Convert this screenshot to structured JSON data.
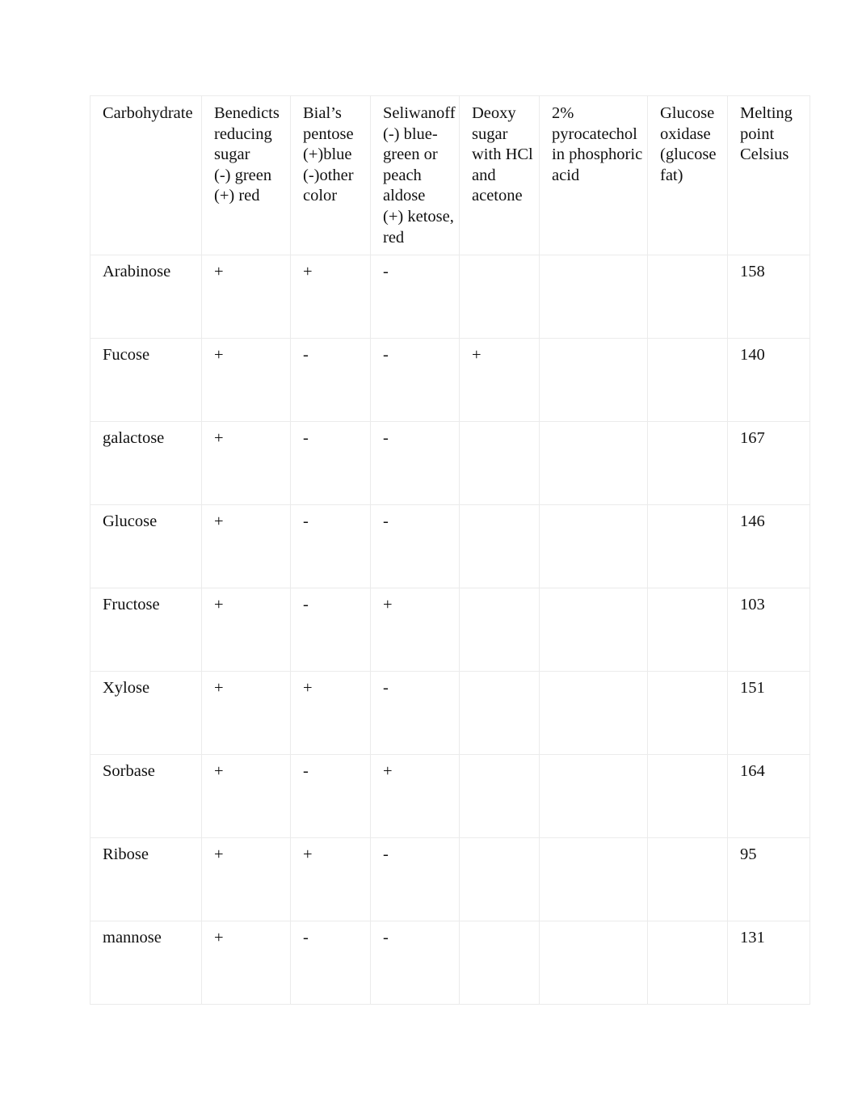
{
  "document": {
    "page_background": "#ffffff",
    "table_border_color": "#ebebeb",
    "text_color": "#111111"
  },
  "table": {
    "headers": [
      "Carbohydrate",
      "Benedicts reducing sugar\n(-) green\n(+) red",
      "Bial’s pentose\n(+)blue\n(-)other color",
      "Seliwanoff\n(-) blue-green or peach aldose\n(+) ketose, red",
      "Deoxy sugar with HCl and acetone",
      "2% pyrocatechol in phosphoric acid",
      "Glucose oxidase (glucose fat)",
      "Melting point Celsius"
    ],
    "rows": [
      {
        "carbohydrate": "Arabinose",
        "benedicts": "+",
        "bials": "+",
        "seliwanoff": "-",
        "deoxy_sugar": "",
        "pyrocatechol": "",
        "glucose_oxidase": "",
        "melting_point": "158"
      },
      {
        "carbohydrate": "Fucose",
        "benedicts": "+",
        "bials": "-",
        "seliwanoff": "-",
        "deoxy_sugar": "+",
        "pyrocatechol": "",
        "glucose_oxidase": "",
        "melting_point": "140"
      },
      {
        "carbohydrate": "galactose",
        "benedicts": "+",
        "bials": "-",
        "seliwanoff": "-",
        "deoxy_sugar": "",
        "pyrocatechol": "",
        "glucose_oxidase": "",
        "melting_point": "167"
      },
      {
        "carbohydrate": "Glucose",
        "benedicts": "+",
        "bials": "-",
        "seliwanoff": "-",
        "deoxy_sugar": "",
        "pyrocatechol": "",
        "glucose_oxidase": "",
        "melting_point": "146"
      },
      {
        "carbohydrate": "Fructose",
        "benedicts": "+",
        "bials": "-",
        "seliwanoff": "+",
        "deoxy_sugar": "",
        "pyrocatechol": "",
        "glucose_oxidase": "",
        "melting_point": "103"
      },
      {
        "carbohydrate": "Xylose",
        "benedicts": "+",
        "bials": "+",
        "seliwanoff": "-",
        "deoxy_sugar": "",
        "pyrocatechol": "",
        "glucose_oxidase": "",
        "melting_point": "151"
      },
      {
        "carbohydrate": "Sorbase",
        "benedicts": "+",
        "bials": "-",
        "seliwanoff": "+",
        "deoxy_sugar": "",
        "pyrocatechol": "",
        "glucose_oxidase": "",
        "melting_point": "164"
      },
      {
        "carbohydrate": "Ribose",
        "benedicts": "+",
        "bials": "+",
        "seliwanoff": "-",
        "deoxy_sugar": "",
        "pyrocatechol": "",
        "glucose_oxidase": "",
        "melting_point": "95"
      },
      {
        "carbohydrate": "mannose",
        "benedicts": "+",
        "bials": "-",
        "seliwanoff": "-",
        "deoxy_sugar": "",
        "pyrocatechol": "",
        "glucose_oxidase": "",
        "melting_point": "131"
      }
    ]
  }
}
